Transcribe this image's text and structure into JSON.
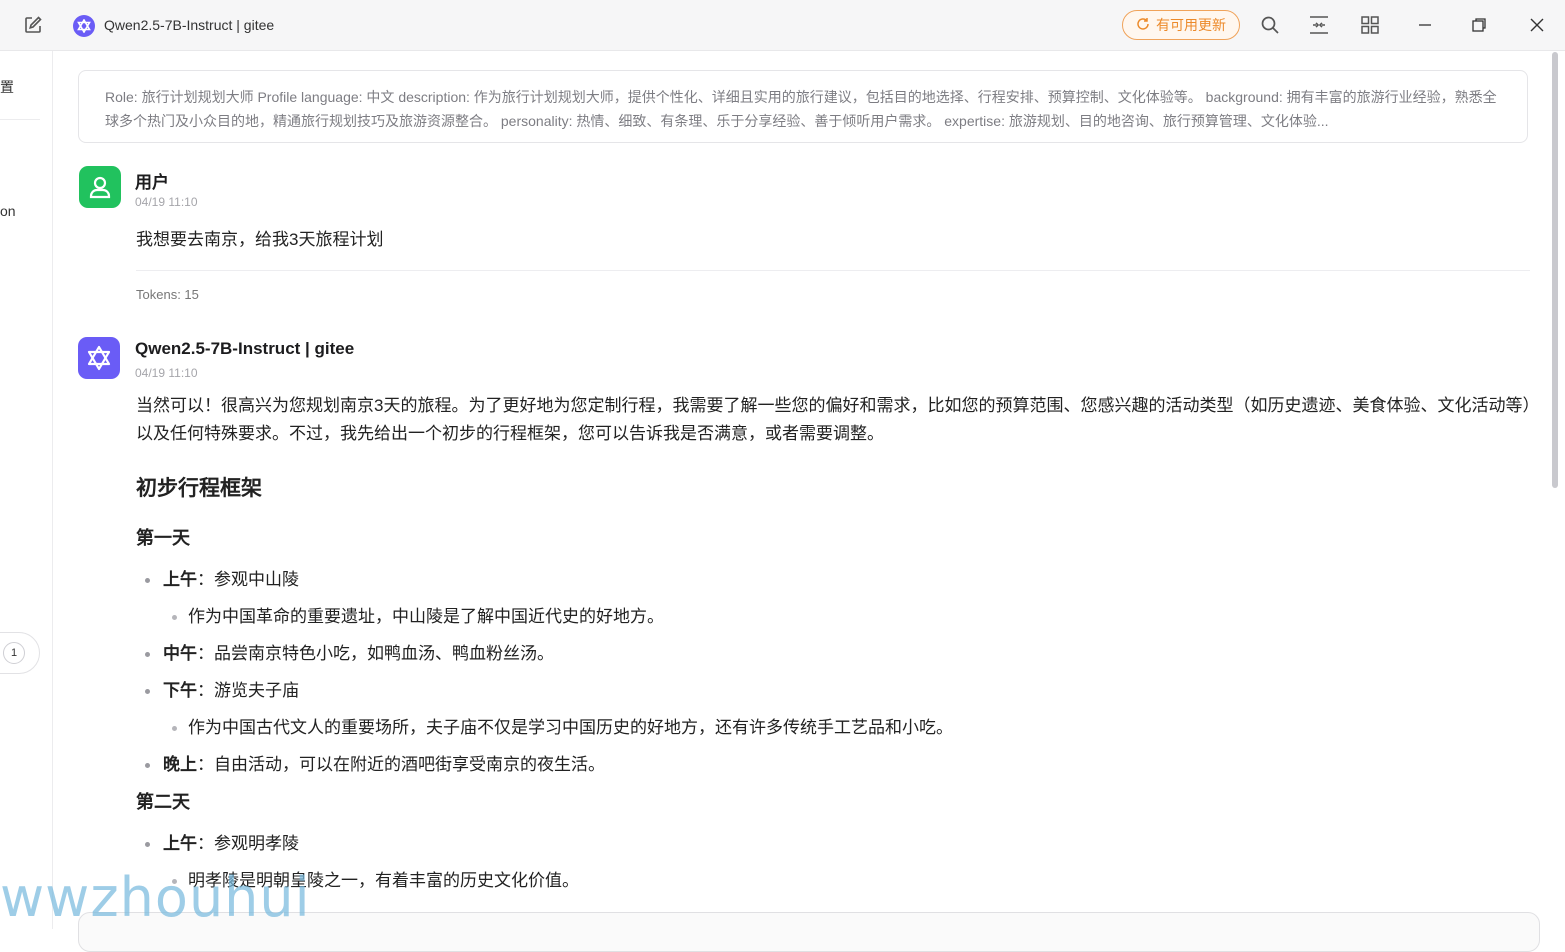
{
  "titlebar": {
    "model_title": "Qwen2.5-7B-Instruct | gitee",
    "update_label": "有可用更新"
  },
  "sidebar": {
    "fragment_top": "置",
    "fragment_mid": "on",
    "badge_count": "1"
  },
  "system_prompt": "Role: 旅行计划规划大师 Profile language: 中文 description: 作为旅行计划规划大师，提供个性化、详细且实用的旅行建议，包括目的地选择、行程安排、预算控制、文化体验等。 background: 拥有丰富的旅游行业经验，熟悉全球多个热门及小众目的地，精通旅行规划技巧及旅游资源整合。 personality: 热情、细致、有条理、乐于分享经验、善于倾听用户需求。 expertise: 旅游规划、目的地咨询、旅行预算管理、文化体验...",
  "user_message": {
    "name": "用户",
    "time": "04/19 11:10",
    "text": "我想要去南京，给我3天旅程计划",
    "tokens": "Tokens: 15"
  },
  "bot_message": {
    "name": "Qwen2.5-7B-Instruct | gitee",
    "time": "04/19 11:10",
    "intro": "当然可以！很高兴为您规划南京3天的旅程。为了更好地为您定制行程，我需要了解一些您的偏好和需求，比如您的预算范围、您感兴趣的活动类型（如历史遗迹、美食体验、文化活动等）以及任何特殊要求。不过，我先给出一个初步的行程框架，您可以告诉我是否满意，或者需要调整。",
    "heading": "初步行程框架",
    "day1": {
      "title": "第一天",
      "items": [
        {
          "label": "上午",
          "text": "：参观中山陵",
          "sub": "作为中国革命的重要遗址，中山陵是了解中国近代史的好地方。"
        },
        {
          "label": "中午",
          "text": "：品尝南京特色小吃，如鸭血汤、鸭血粉丝汤。",
          "sub": ""
        },
        {
          "label": "下午",
          "text": "：游览夫子庙",
          "sub": "作为中国古代文人的重要场所，夫子庙不仅是学习中国历史的好地方，还有许多传统手工艺品和小吃。"
        },
        {
          "label": "晚上",
          "text": "：自由活动，可以在附近的酒吧街享受南京的夜生活。",
          "sub": ""
        }
      ]
    },
    "day2": {
      "title": "第二天",
      "items": [
        {
          "label": "上午",
          "text": "：参观明孝陵",
          "sub": "明孝陵是明朝皇陵之一，有着丰富的历史文化价值。"
        }
      ]
    }
  },
  "watermark": "wwzhouhui",
  "colors": {
    "accent_purple": "#6a5cf6",
    "user_green": "#21c25e",
    "update_orange": "#ec8a2a"
  }
}
